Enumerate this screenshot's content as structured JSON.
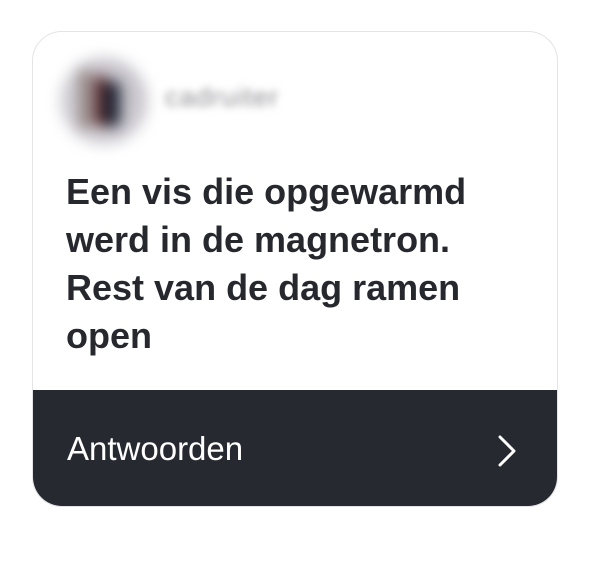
{
  "card": {
    "username": "cadruiter",
    "message": "Een vis die opgewarmd werd in de magnetron. Rest van de dag ramen open",
    "reply_label": "Antwoorden",
    "avatar_icon": "profile-avatar",
    "chevron_icon": "chevron-right-icon"
  },
  "colors": {
    "reply_bar": "#272930",
    "message_text": "#26282e",
    "card_border": "#e4e4e6"
  }
}
